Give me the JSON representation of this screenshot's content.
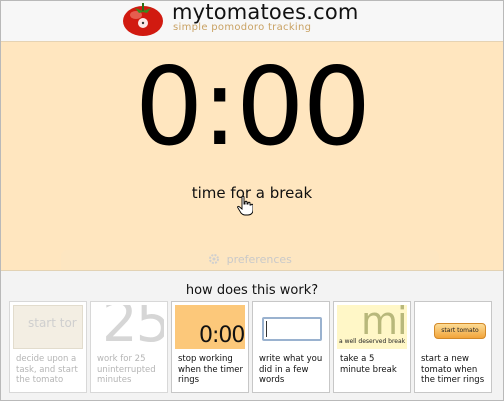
{
  "header": {
    "site_title": "mytomatoes.com",
    "tagline": "simple pomodoro tracking"
  },
  "timer": {
    "display": "0:00",
    "status": "time for a break"
  },
  "preferences": {
    "label": "preferences"
  },
  "how_it_works": {
    "title": "how does this work?",
    "steps": [
      {
        "thumb_text": "start tor",
        "caption": "decide upon a task, and start the tomato"
      },
      {
        "thumb_text": "25",
        "caption": "work for 25 uninterrupted minutes"
      },
      {
        "thumb_text": "0:00",
        "caption": "stop working when the timer rings"
      },
      {
        "thumb_text": "",
        "caption": "write what you did in a few words"
      },
      {
        "thumb_text": "mir",
        "thumb_subtext": "a well deserved break",
        "caption": "take a 5 minute break"
      },
      {
        "thumb_text": "start tomato",
        "caption": "start a new tomato when the timer rings"
      }
    ]
  },
  "colors": {
    "timer_panel": "#ffe6bf",
    "tagline": "#c9a264",
    "tomato": "#d11a10"
  }
}
